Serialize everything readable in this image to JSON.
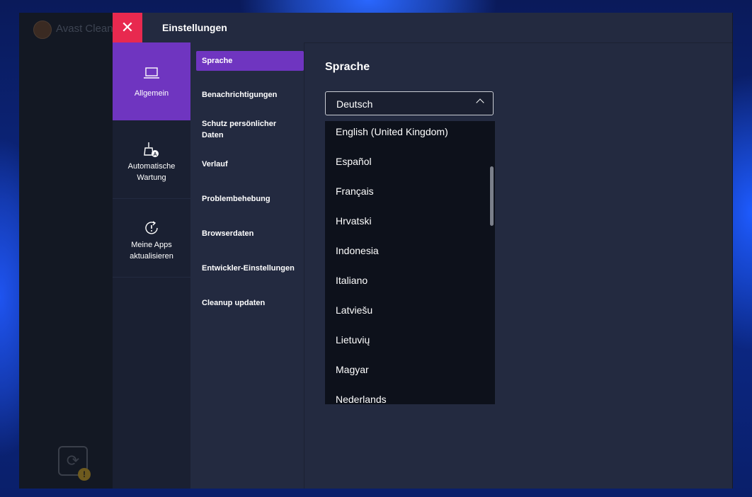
{
  "back_app": {
    "title": "Avast Clean",
    "badge_icon": "exclamation"
  },
  "dialog": {
    "title": "Einstellungen",
    "close_glyph": "✕"
  },
  "categories": [
    {
      "label": "Allgemein",
      "icon": "laptop-icon",
      "active": true
    },
    {
      "label": "Automatische Wartung",
      "icon": "broom-auto-icon",
      "active": false
    },
    {
      "label": "Meine Apps aktualisieren",
      "icon": "update-alert-icon",
      "active": false
    }
  ],
  "submenu": [
    {
      "label": "Sprache",
      "active": true
    },
    {
      "label": "Benachrichtigungen"
    },
    {
      "label": "Schutz persönlicher Daten"
    },
    {
      "label": "Verlauf"
    },
    {
      "label": "Problembehebung"
    },
    {
      "label": "Browserdaten"
    },
    {
      "label": "Entwickler-Einstellungen"
    },
    {
      "label": "Cleanup updaten"
    }
  ],
  "content": {
    "section_title": "Sprache",
    "select": {
      "value": "Deutsch",
      "options": [
        "English (United Kingdom)",
        "Español",
        "Français",
        "Hrvatski",
        "Indonesia",
        "Italiano",
        "Latviešu",
        "Lietuvių",
        "Magyar",
        "Nederlands"
      ]
    }
  },
  "colors": {
    "accent": "#6f35c0",
    "close": "#e8294f",
    "panel": "#232a40",
    "dropdown": "#0d111b"
  }
}
